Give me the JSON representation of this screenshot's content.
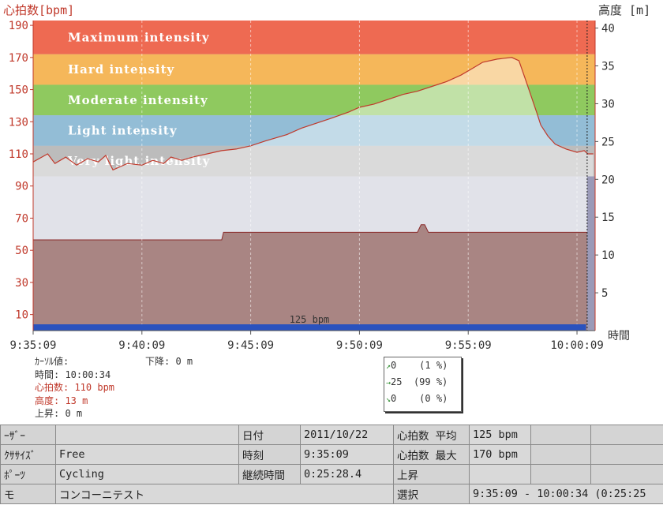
{
  "chart_data": {
    "type": "line",
    "y_left_label": "心拍数[bpm]",
    "y_right_label": "高度 [m]",
    "x_axis_label": "時間",
    "x_ticks": [
      "9:35:09",
      "9:40:09",
      "9:45:09",
      "9:50:09",
      "9:55:09",
      "10:00:09"
    ],
    "xlim_seconds_from_start": [
      0,
      1550
    ],
    "y_left_ticks": [
      10,
      30,
      50,
      70,
      90,
      110,
      130,
      150,
      170,
      190
    ],
    "y_left_range": [
      0,
      193
    ],
    "y_right_ticks": [
      5,
      10,
      15,
      20,
      25,
      30,
      35,
      40
    ],
    "y_right_range": [
      0,
      41
    ],
    "zones": [
      {
        "label": "Maximum intensity",
        "from": 172,
        "to": 193,
        "color": "#ee6a52"
      },
      {
        "label": "Hard intensity",
        "from": 153,
        "to": 172,
        "color": "#f5b75a"
      },
      {
        "label": "Moderate intensity",
        "from": 134,
        "to": 153,
        "color": "#8fc95f"
      },
      {
        "label": "Light intensity",
        "from": 115,
        "to": 134,
        "color": "#93bdd6"
      },
      {
        "label": "Very light intensity",
        "from": 96,
        "to": 115,
        "color": "#bcbcbc"
      }
    ],
    "below_zone_color": "#c9cbd8",
    "series": [
      {
        "name": "心拍数",
        "unit": "bpm",
        "color": "#c0392b",
        "x": [
          0,
          40,
          60,
          90,
          120,
          150,
          180,
          200,
          220,
          260,
          300,
          330,
          360,
          380,
          410,
          440,
          480,
          520,
          560,
          600,
          640,
          700,
          740,
          780,
          820,
          870,
          900,
          940,
          980,
          1020,
          1060,
          1100,
          1140,
          1180,
          1210,
          1240,
          1280,
          1320,
          1340,
          1360,
          1390,
          1400,
          1420,
          1440,
          1470,
          1500,
          1520,
          1530,
          1545
        ],
        "values": [
          105,
          110,
          104,
          108,
          103,
          107,
          105,
          109,
          100,
          104,
          103,
          106,
          104,
          108,
          106,
          108,
          110,
          112,
          113,
          115,
          118,
          122,
          126,
          129,
          132,
          136,
          139,
          141,
          144,
          147,
          149,
          152,
          155,
          159,
          163,
          167,
          169,
          170,
          168,
          155,
          135,
          128,
          121,
          116,
          113,
          111,
          112,
          110,
          110
        ]
      },
      {
        "name": "高度",
        "unit": "m",
        "color": "#8b2a2a",
        "fill": "#a98583",
        "x": [
          0,
          520,
          525,
          1060,
          1070,
          1080,
          1090,
          1545
        ],
        "values": [
          12,
          12,
          13,
          13,
          14,
          14,
          13,
          13
        ]
      }
    ],
    "annotations": {
      "average_label": "125 bpm"
    }
  },
  "cursor": {
    "title": "ｶｰｿﾙ値:",
    "time": "時間: 10:00:34",
    "heart_rate": "心拍数: 110 bpm",
    "altitude": "高度: 13 m",
    "ascent": "上昇: 0 m",
    "descent": "下降: 0 m"
  },
  "legend": [
    {
      "symbol": "↗",
      "value": "0",
      "pct": "(1 %)"
    },
    {
      "symbol": "→",
      "value": "25",
      "pct": "(99 %)"
    },
    {
      "symbol": "↘",
      "value": "0",
      "pct": "(0 %)"
    }
  ],
  "info": {
    "user_label": "ｰｻﾞｰ",
    "user_value": "",
    "exercise_label": "ｸｻｻｲｽﾞ",
    "exercise_value": "Free",
    "sport_label": "ﾎﾟｰﾂ",
    "sport_value": "Cycling",
    "memo_label": "モ",
    "memo_value": "コンコーニテスト",
    "date_label": "日付",
    "date_value": "2011/10/22",
    "time_label": "時刻",
    "time_value": "9:35:09",
    "duration_label": "継続時間",
    "duration_value": "0:25:28.4",
    "select_label": "選択",
    "select_value": "9:35:09 - 10:00:34 (0:25:25",
    "avg_hr_label": "心拍数 平均",
    "avg_hr_value": "125 bpm",
    "max_hr_label": "心拍数 最大",
    "max_hr_value": "170 bpm",
    "ascent_label": "上昇",
    "ascent_value": ""
  }
}
